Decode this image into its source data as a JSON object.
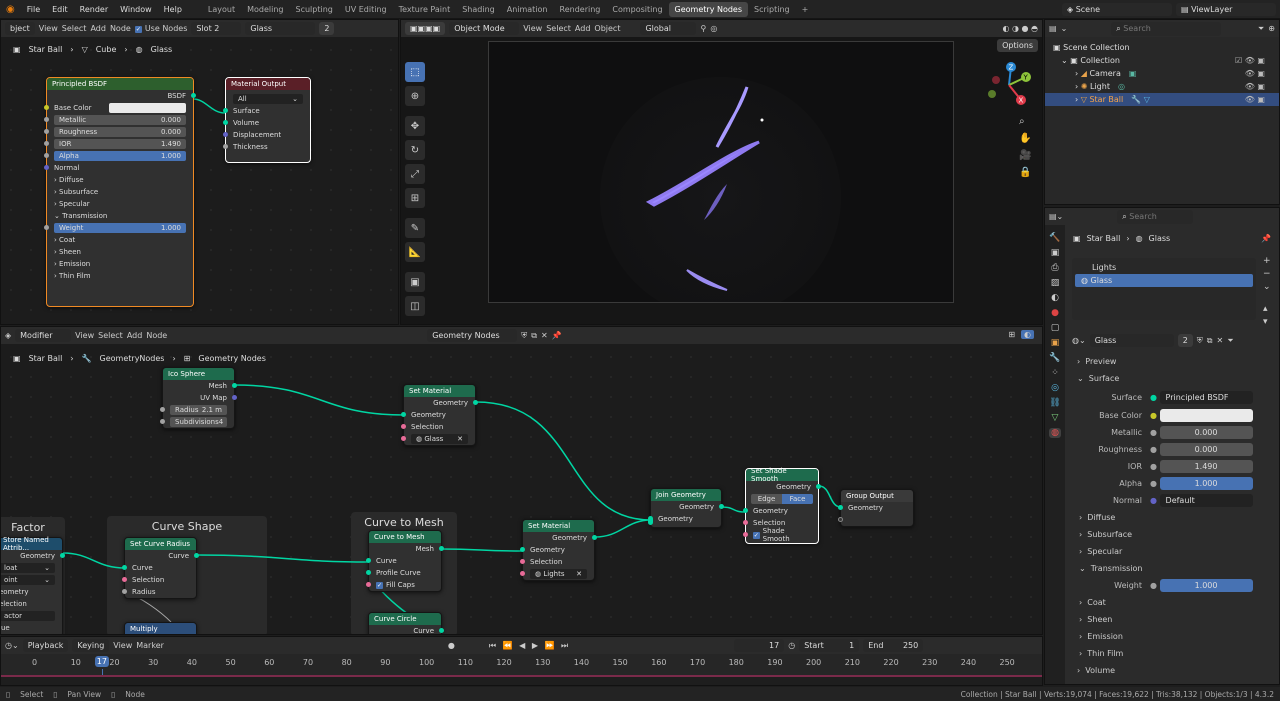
{
  "topbar": {
    "menus": [
      "File",
      "Edit",
      "Render",
      "Window",
      "Help"
    ],
    "workspaces": [
      "Layout",
      "Modeling",
      "Sculpting",
      "UV Editing",
      "Texture Paint",
      "Shading",
      "Animation",
      "Rendering",
      "Compositing",
      "Geometry Nodes",
      "Scripting"
    ],
    "active_workspace": "Geometry Nodes",
    "add_tab": "+",
    "scene": "Scene",
    "view_layer": "ViewLayer"
  },
  "shader_editor": {
    "header": {
      "type": "bject",
      "menus": [
        "View",
        "Select",
        "Add",
        "Node"
      ],
      "use_nodes": "Use Nodes",
      "slot": "Slot 2",
      "material": "Glass",
      "users": "2"
    },
    "breadcrumb": [
      "Star Ball",
      "Cube",
      "Glass"
    ],
    "bsdf": {
      "title": "Principled BSDF",
      "out": "BSDF",
      "base_color": "Base Color",
      "metallic": "Metallic",
      "metallic_v": "0.000",
      "roughness": "Roughness",
      "roughness_v": "0.000",
      "ior": "IOR",
      "ior_v": "1.490",
      "alpha": "Alpha",
      "alpha_v": "1.000",
      "normal": "Normal",
      "panels": [
        "Diffuse",
        "Subsurface",
        "Specular",
        "Transmission"
      ],
      "weight": "Weight",
      "weight_v": "1.000",
      "panels2": [
        "Coat",
        "Sheen",
        "Emission",
        "Thin Film"
      ]
    },
    "output": {
      "title": "Material Output",
      "target": "All",
      "inputs": [
        "Surface",
        "Volume",
        "Displacement",
        "Thickness"
      ]
    }
  },
  "viewport": {
    "mode": "Object Mode",
    "menus": [
      "View",
      "Select",
      "Add",
      "Object"
    ],
    "orientation": "Global",
    "options": "Options",
    "axes": [
      "Z",
      "Y",
      "X"
    ]
  },
  "gn_editor": {
    "header": {
      "type": "Modifier",
      "menus": [
        "View",
        "Select",
        "Add",
        "Node"
      ],
      "tree": "Geometry Nodes"
    },
    "breadcrumb": [
      "Star Ball",
      "GeometryNodes",
      "Geometry Nodes"
    ],
    "ico": {
      "title": "Ico Sphere",
      "mesh": "Mesh",
      "uv": "UV Map",
      "radius": "Radius",
      "radius_v": "2.1 m",
      "subdiv": "Subdivisions",
      "subdiv_v": "4"
    },
    "setmat1": {
      "title": "Set Material",
      "geo": "Geometry",
      "geo_in": "Geometry",
      "sel": "Selection",
      "mat": "Glass"
    },
    "join": {
      "title": "Join Geometry",
      "geo": "Geometry",
      "geo_in": "Geometry"
    },
    "shade": {
      "title": "Set Shade Smooth",
      "geo": "Geometry",
      "edge": "Edge",
      "face": "Face",
      "geo_in": "Geometry",
      "sel": "Selection",
      "smooth": "Shade Smooth"
    },
    "groupout": {
      "title": "Group Output",
      "geo": "Geometry"
    },
    "frame_factor": "Factor",
    "frame_curve_shape": "Curve Shape",
    "frame_curve_mesh": "Curve to Mesh",
    "store": {
      "title": "Store Named Attrib...",
      "geo": "Geometry",
      "dtype": "loat",
      "domain": "oint",
      "r1": "eometry",
      "r2": "election",
      "r3": "actor",
      "r4": "lue"
    },
    "radius": {
      "title": "Set Curve Radius",
      "curve": "Curve",
      "curve_in": "Curve",
      "sel": "Selection",
      "radius": "Radius"
    },
    "multiply": {
      "title": "Multiply"
    },
    "c2m": {
      "title": "Curve to Mesh",
      "mesh": "Mesh",
      "curve": "Curve",
      "profile": "Profile Curve",
      "caps": "Fill Caps"
    },
    "circle": {
      "title": "Curve Circle",
      "curve": "Curve"
    },
    "setmat2": {
      "title": "Set Material",
      "geo": "Geometry",
      "geo_in": "Geometry",
      "sel": "Selection",
      "mat": "Lights"
    }
  },
  "outliner": {
    "search": "Search",
    "items": [
      {
        "name": "Scene Collection"
      },
      {
        "name": "Collection"
      },
      {
        "name": "Camera"
      },
      {
        "name": "Light"
      },
      {
        "name": "Star Ball"
      }
    ]
  },
  "properties": {
    "search": "Search",
    "breadcrumb": [
      "Star Ball",
      "Glass"
    ],
    "slots": [
      "Lights",
      "Glass"
    ],
    "material": "Glass",
    "users": "2",
    "preview": "Preview",
    "surface": "Surface",
    "surface_label": "Surface",
    "surface_v": "Principled BSDF",
    "rows": [
      {
        "l": "Base Color",
        "v": ""
      },
      {
        "l": "Metallic",
        "v": "0.000"
      },
      {
        "l": "Roughness",
        "v": "0.000"
      },
      {
        "l": "IOR",
        "v": "1.490"
      },
      {
        "l": "Alpha",
        "v": "1.000"
      },
      {
        "l": "Normal",
        "v": "Default"
      }
    ],
    "diffuse": "Diffuse",
    "subsurface": "Subsurface",
    "specular": "Specular",
    "transmission": "Transmission",
    "weight": "Weight",
    "weight_v": "1.000",
    "coat": "Coat",
    "sheen": "Sheen",
    "emission": "Emission",
    "thinfilm": "Thin Film",
    "volume": "Volume"
  },
  "timeline": {
    "menus": [
      "Playback",
      "Keying",
      "View",
      "Marker"
    ],
    "current": "17",
    "start_label": "Start",
    "start": "1",
    "end_label": "End",
    "end": "250",
    "ticks": [
      "0",
      "10",
      "20",
      "30",
      "40",
      "50",
      "60",
      "70",
      "80",
      "90",
      "100",
      "110",
      "120",
      "130",
      "140",
      "150",
      "160",
      "170",
      "180",
      "190",
      "200",
      "210",
      "220",
      "230",
      "240",
      "250"
    ],
    "playhead": "17"
  },
  "status": {
    "select": "Select",
    "pan": "Pan View",
    "node": "Node",
    "info": "Collection | Star Ball | Verts:19,074 | Faces:19,622 | Tris:38,132 | Objects:1/3 | 4.3.2"
  }
}
